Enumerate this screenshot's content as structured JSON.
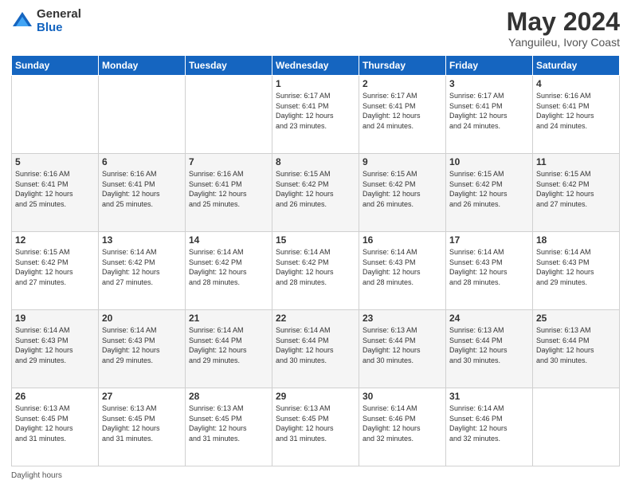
{
  "logo": {
    "general": "General",
    "blue": "Blue"
  },
  "header": {
    "month": "May 2024",
    "location": "Yanguileu, Ivory Coast"
  },
  "days_of_week": [
    "Sunday",
    "Monday",
    "Tuesday",
    "Wednesday",
    "Thursday",
    "Friday",
    "Saturday"
  ],
  "weeks": [
    [
      {
        "day": "",
        "info": ""
      },
      {
        "day": "",
        "info": ""
      },
      {
        "day": "",
        "info": ""
      },
      {
        "day": "1",
        "info": "Sunrise: 6:17 AM\nSunset: 6:41 PM\nDaylight: 12 hours\nand 23 minutes."
      },
      {
        "day": "2",
        "info": "Sunrise: 6:17 AM\nSunset: 6:41 PM\nDaylight: 12 hours\nand 24 minutes."
      },
      {
        "day": "3",
        "info": "Sunrise: 6:17 AM\nSunset: 6:41 PM\nDaylight: 12 hours\nand 24 minutes."
      },
      {
        "day": "4",
        "info": "Sunrise: 6:16 AM\nSunset: 6:41 PM\nDaylight: 12 hours\nand 24 minutes."
      }
    ],
    [
      {
        "day": "5",
        "info": "Sunrise: 6:16 AM\nSunset: 6:41 PM\nDaylight: 12 hours\nand 25 minutes."
      },
      {
        "day": "6",
        "info": "Sunrise: 6:16 AM\nSunset: 6:41 PM\nDaylight: 12 hours\nand 25 minutes."
      },
      {
        "day": "7",
        "info": "Sunrise: 6:16 AM\nSunset: 6:41 PM\nDaylight: 12 hours\nand 25 minutes."
      },
      {
        "day": "8",
        "info": "Sunrise: 6:15 AM\nSunset: 6:42 PM\nDaylight: 12 hours\nand 26 minutes."
      },
      {
        "day": "9",
        "info": "Sunrise: 6:15 AM\nSunset: 6:42 PM\nDaylight: 12 hours\nand 26 minutes."
      },
      {
        "day": "10",
        "info": "Sunrise: 6:15 AM\nSunset: 6:42 PM\nDaylight: 12 hours\nand 26 minutes."
      },
      {
        "day": "11",
        "info": "Sunrise: 6:15 AM\nSunset: 6:42 PM\nDaylight: 12 hours\nand 27 minutes."
      }
    ],
    [
      {
        "day": "12",
        "info": "Sunrise: 6:15 AM\nSunset: 6:42 PM\nDaylight: 12 hours\nand 27 minutes."
      },
      {
        "day": "13",
        "info": "Sunrise: 6:14 AM\nSunset: 6:42 PM\nDaylight: 12 hours\nand 27 minutes."
      },
      {
        "day": "14",
        "info": "Sunrise: 6:14 AM\nSunset: 6:42 PM\nDaylight: 12 hours\nand 28 minutes."
      },
      {
        "day": "15",
        "info": "Sunrise: 6:14 AM\nSunset: 6:42 PM\nDaylight: 12 hours\nand 28 minutes."
      },
      {
        "day": "16",
        "info": "Sunrise: 6:14 AM\nSunset: 6:43 PM\nDaylight: 12 hours\nand 28 minutes."
      },
      {
        "day": "17",
        "info": "Sunrise: 6:14 AM\nSunset: 6:43 PM\nDaylight: 12 hours\nand 28 minutes."
      },
      {
        "day": "18",
        "info": "Sunrise: 6:14 AM\nSunset: 6:43 PM\nDaylight: 12 hours\nand 29 minutes."
      }
    ],
    [
      {
        "day": "19",
        "info": "Sunrise: 6:14 AM\nSunset: 6:43 PM\nDaylight: 12 hours\nand 29 minutes."
      },
      {
        "day": "20",
        "info": "Sunrise: 6:14 AM\nSunset: 6:43 PM\nDaylight: 12 hours\nand 29 minutes."
      },
      {
        "day": "21",
        "info": "Sunrise: 6:14 AM\nSunset: 6:44 PM\nDaylight: 12 hours\nand 29 minutes."
      },
      {
        "day": "22",
        "info": "Sunrise: 6:14 AM\nSunset: 6:44 PM\nDaylight: 12 hours\nand 30 minutes."
      },
      {
        "day": "23",
        "info": "Sunrise: 6:13 AM\nSunset: 6:44 PM\nDaylight: 12 hours\nand 30 minutes."
      },
      {
        "day": "24",
        "info": "Sunrise: 6:13 AM\nSunset: 6:44 PM\nDaylight: 12 hours\nand 30 minutes."
      },
      {
        "day": "25",
        "info": "Sunrise: 6:13 AM\nSunset: 6:44 PM\nDaylight: 12 hours\nand 30 minutes."
      }
    ],
    [
      {
        "day": "26",
        "info": "Sunrise: 6:13 AM\nSunset: 6:45 PM\nDaylight: 12 hours\nand 31 minutes."
      },
      {
        "day": "27",
        "info": "Sunrise: 6:13 AM\nSunset: 6:45 PM\nDaylight: 12 hours\nand 31 minutes."
      },
      {
        "day": "28",
        "info": "Sunrise: 6:13 AM\nSunset: 6:45 PM\nDaylight: 12 hours\nand 31 minutes."
      },
      {
        "day": "29",
        "info": "Sunrise: 6:13 AM\nSunset: 6:45 PM\nDaylight: 12 hours\nand 31 minutes."
      },
      {
        "day": "30",
        "info": "Sunrise: 6:14 AM\nSunset: 6:46 PM\nDaylight: 12 hours\nand 32 minutes."
      },
      {
        "day": "31",
        "info": "Sunrise: 6:14 AM\nSunset: 6:46 PM\nDaylight: 12 hours\nand 32 minutes."
      },
      {
        "day": "",
        "info": ""
      }
    ]
  ],
  "footer": {
    "label": "Daylight hours"
  }
}
